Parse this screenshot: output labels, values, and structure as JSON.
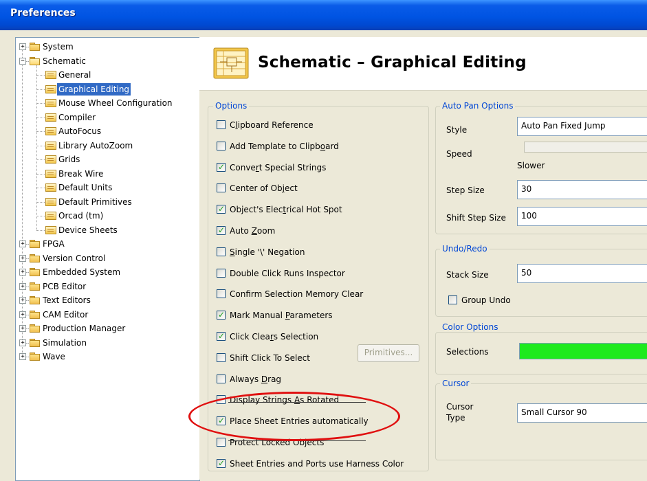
{
  "window": {
    "title": "Preferences"
  },
  "tree": {
    "items": [
      {
        "label": "System",
        "level": 0,
        "expander": "+"
      },
      {
        "label": "Schematic",
        "level": 0,
        "expander": "-"
      },
      {
        "label": "General",
        "level": 1
      },
      {
        "label": "Graphical Editing",
        "level": 1,
        "selected": true
      },
      {
        "label": "Mouse Wheel Configuration",
        "level": 1
      },
      {
        "label": "Compiler",
        "level": 1
      },
      {
        "label": "AutoFocus",
        "level": 1
      },
      {
        "label": "Library AutoZoom",
        "level": 1
      },
      {
        "label": "Grids",
        "level": 1
      },
      {
        "label": "Break Wire",
        "level": 1
      },
      {
        "label": "Default Units",
        "level": 1
      },
      {
        "label": "Default Primitives",
        "level": 1
      },
      {
        "label": "Orcad (tm)",
        "level": 1
      },
      {
        "label": "Device Sheets",
        "level": 1
      },
      {
        "label": "FPGA",
        "level": 0,
        "expander": "+"
      },
      {
        "label": "Version Control",
        "level": 0,
        "expander": "+"
      },
      {
        "label": "Embedded System",
        "level": 0,
        "expander": "+"
      },
      {
        "label": "PCB Editor",
        "level": 0,
        "expander": "+"
      },
      {
        "label": "Text Editors",
        "level": 0,
        "expander": "+"
      },
      {
        "label": "CAM Editor",
        "level": 0,
        "expander": "+"
      },
      {
        "label": "Production Manager",
        "level": 0,
        "expander": "+"
      },
      {
        "label": "Simulation",
        "level": 0,
        "expander": "+"
      },
      {
        "label": "Wave",
        "level": 0,
        "expander": "+"
      }
    ]
  },
  "header": {
    "title": "Schematic – Graphical Editing"
  },
  "options": {
    "label": "Options",
    "items": [
      {
        "label": "Clipboard Reference",
        "checked": false
      },
      {
        "label": "Add Template to Clipboard",
        "checked": false
      },
      {
        "label": "Convert Special Strings",
        "checked": true
      },
      {
        "label": "Center of Object",
        "checked": false
      },
      {
        "label": "Object's Electrical Hot Spot",
        "checked": true
      },
      {
        "label": "Auto Zoom",
        "checked": true
      },
      {
        "label": "Single '\\' Negation",
        "checked": false
      },
      {
        "label": "Double Click Runs Inspector",
        "checked": false
      },
      {
        "label": "Confirm Selection Memory Clear",
        "checked": false
      },
      {
        "label": "Mark Manual Parameters",
        "checked": true
      },
      {
        "label": "Click Clears Selection",
        "checked": true
      },
      {
        "label": "Shift Click To Select",
        "checked": false
      },
      {
        "label": "Always Drag",
        "checked": false
      },
      {
        "label": "Display Strings As Rotated",
        "checked": false
      },
      {
        "label": "Place Sheet Entries automatically",
        "checked": true
      },
      {
        "label": "Protect Locked Objects",
        "checked": false
      },
      {
        "label": "Sheet Entries and Ports use Harness Color",
        "checked": true
      }
    ],
    "primitives_button": "Primitives..."
  },
  "auto_pan": {
    "label": "Auto Pan Options",
    "style_label": "Style",
    "style_value": "Auto Pan Fixed Jump",
    "speed_label": "Speed",
    "speed_caption": "Slower",
    "step_size_label": "Step Size",
    "step_size_value": "30",
    "shift_step_label": "Shift Step Size",
    "shift_step_value": "100"
  },
  "undo_redo": {
    "label": "Undo/Redo",
    "stack_label": "Stack Size",
    "stack_value": "50",
    "group_undo_label": "Group Undo",
    "group_undo_checked": false
  },
  "color_options": {
    "label": "Color Options",
    "selections_label": "Selections",
    "selections_color": "#1eea1e"
  },
  "cursor": {
    "label": "Cursor",
    "type_label_1": "Cursor",
    "type_label_2": "Type",
    "type_value": "Small Cursor 90"
  },
  "colors": {
    "accent": "#0046d5",
    "selection": "#316ac5",
    "highlight_ring": "#e01010"
  }
}
